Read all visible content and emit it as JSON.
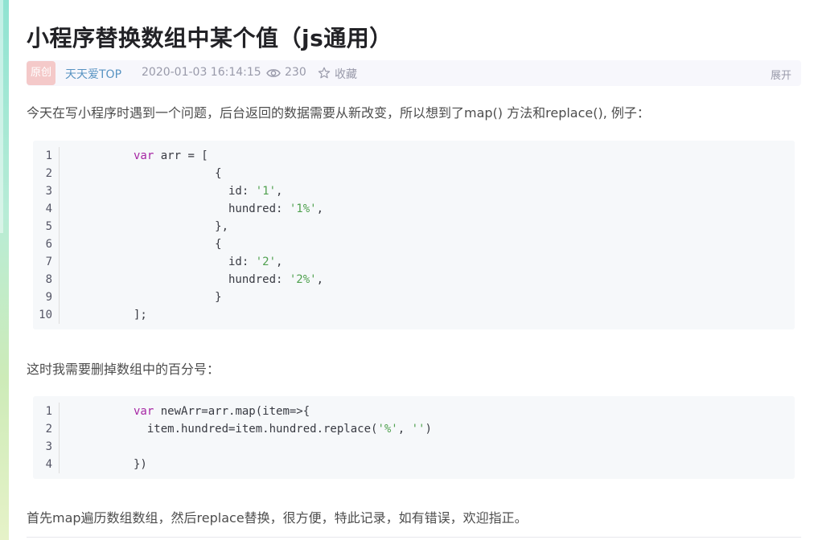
{
  "article": {
    "title": "小程序替换数组中某个值（js通用）",
    "meta": {
      "badge": "原创",
      "author": "天天爱TOP",
      "date": "2020-01-03 16:14:15",
      "views": "230",
      "favorite_label": "收藏",
      "expand_label": "展开"
    },
    "paragraphs": [
      "今天在写小程序时遇到一个问题，后台返回的数据需要从新改变，所以想到了map() 方法和replace(), 例子：",
      "这时我需要删掉数组中的百分号：",
      "首先map遍历数组数组，然后replace替换，很方便，特此记录，如有错误，欢迎指正。"
    ],
    "code_blocks": [
      {
        "line_numbers": [
          "1",
          "2",
          "3",
          "4",
          "5",
          "6",
          "7",
          "8",
          "9",
          "10"
        ],
        "lines": [
          [
            {
              "t": "var",
              "k": "kw"
            },
            {
              "t": " arr = ["
            }
          ],
          [
            {
              "t": "            {"
            }
          ],
          [
            {
              "t": "              id: "
            },
            {
              "t": "'1'",
              "k": "str"
            },
            {
              "t": ","
            }
          ],
          [
            {
              "t": "              hundred: "
            },
            {
              "t": "'1%'",
              "k": "str"
            },
            {
              "t": ","
            }
          ],
          [
            {
              "t": "            },"
            }
          ],
          [
            {
              "t": "            {"
            }
          ],
          [
            {
              "t": "              id: "
            },
            {
              "t": "'2'",
              "k": "str"
            },
            {
              "t": ","
            }
          ],
          [
            {
              "t": "              hundred: "
            },
            {
              "t": "'2%'",
              "k": "str"
            },
            {
              "t": ","
            }
          ],
          [
            {
              "t": "            }"
            }
          ],
          [
            {
              "t": "];"
            }
          ]
        ]
      },
      {
        "line_numbers": [
          "1",
          "2",
          "3",
          "4"
        ],
        "lines": [
          [
            {
              "t": "var",
              "k": "kw"
            },
            {
              "t": " newArr=arr.map(item=>{"
            }
          ],
          [
            {
              "t": "  item.hundred=item.hundred.replace("
            },
            {
              "t": "'%'",
              "k": "str"
            },
            {
              "t": ", "
            },
            {
              "t": "''",
              "k": "str"
            },
            {
              "t": ")"
            }
          ],
          [
            {
              "t": ""
            }
          ],
          [
            {
              "t": "})"
            }
          ]
        ]
      }
    ]
  },
  "icons": {
    "views": "eye-icon",
    "favorite": "star-icon"
  },
  "colors": {
    "badge_bg": "#f4c9c9",
    "author_link": "#5893c2",
    "keyword": "#a626a4",
    "string": "#50a14f"
  }
}
